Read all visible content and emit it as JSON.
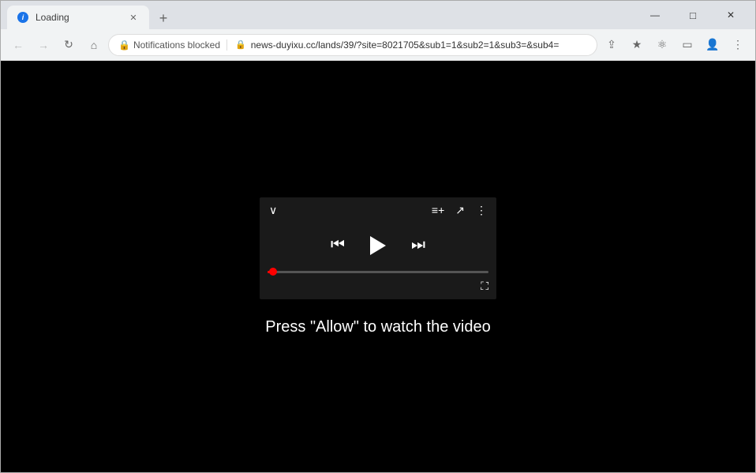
{
  "browser": {
    "tab": {
      "title": "Loading",
      "favicon": "info-icon"
    },
    "new_tab_label": "+",
    "window_controls": {
      "minimize": "—",
      "maximize": "□",
      "close": "✕"
    },
    "nav": {
      "back_label": "←",
      "forward_label": "→",
      "refresh_label": "↻",
      "home_label": "⌂",
      "notifications_blocked": "Notifications blocked",
      "url": "news-duyixu.cc/lands/39/?site=8021705&sub1=1&sub2=1&sub3=&sub4=",
      "share_label": "⇧",
      "bookmark_label": "☆",
      "extensions_label": "🧩",
      "sidebar_label": "▭",
      "profile_label": "👤",
      "menu_label": "⋮"
    }
  },
  "page": {
    "message": "Press \"Allow\" to watch the video",
    "player": {
      "chevron_down": "∨",
      "playlist_icon": "≡+",
      "share_icon": "↗",
      "more_icon": "⋮",
      "skip_prev": "⏮",
      "play": "▶",
      "skip_next": "⏭",
      "fullscreen": "⛶"
    }
  }
}
